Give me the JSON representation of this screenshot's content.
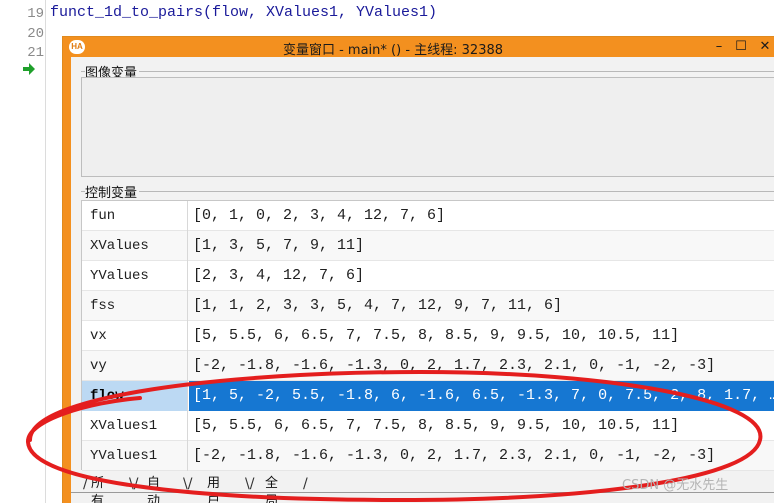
{
  "editor": {
    "line_numbers": [
      "19",
      "20",
      "21"
    ],
    "code_line": "funct_1d_to_pairs(flow, XValues1, YValues1)"
  },
  "window": {
    "logo_text": "HA",
    "title": "变量窗口 - main* () - 主线程: 32388",
    "minimize_label": "–",
    "maximize_label": "☐",
    "close_label": "✕"
  },
  "image_vars": {
    "label": "图像变量"
  },
  "control_vars": {
    "label": "控制变量",
    "rows": [
      {
        "name": "fun",
        "value": "[0, 1, 0, 2, 3, 4, 12, 7, 6]"
      },
      {
        "name": "XValues",
        "value": "[1, 3, 5, 7, 9, 11]"
      },
      {
        "name": "YValues",
        "value": "[2, 3, 4, 12, 7, 6]"
      },
      {
        "name": "fss",
        "value": "[1, 1, 2, 3, 3, 5, 4, 7, 12, 9, 7, 11, 6]"
      },
      {
        "name": "vx",
        "value": "[5, 5.5, 6, 6.5, 7, 7.5, 8, 8.5, 9, 9.5, 10, 10.5, 11]"
      },
      {
        "name": "vy",
        "value": "[-2, -1.8, -1.6, -1.3, 0, 2, 1.7, 2.3, 2.1, 0, -1, -2, -3]"
      },
      {
        "name": "flow",
        "value": "[1, 5, -2, 5.5, -1.8, 6, -1.6, 6.5, -1.3, 7, 0, 7.5, 2, 8, 1.7, …"
      },
      {
        "name": "XValues1",
        "value": "[5, 5.5, 6, 6.5, 7, 7.5, 8, 8.5, 9, 9.5, 10, 10.5, 11]"
      },
      {
        "name": "YValues1",
        "value": "[-2, -1.8, -1.6, -1.3, 0, 2, 1.7, 2.3, 2.1, 0, -1, -2, -3]"
      }
    ],
    "selected_index": 6
  },
  "tabs": [
    {
      "label": "所有"
    },
    {
      "label": "自动"
    },
    {
      "label": "用户"
    },
    {
      "label": "全局"
    }
  ],
  "watermark": "CSDN @无水先生",
  "colors": {
    "window_accent": "#f3901f",
    "selection": "#1677d2",
    "annotation_red": "#e41e1e"
  }
}
